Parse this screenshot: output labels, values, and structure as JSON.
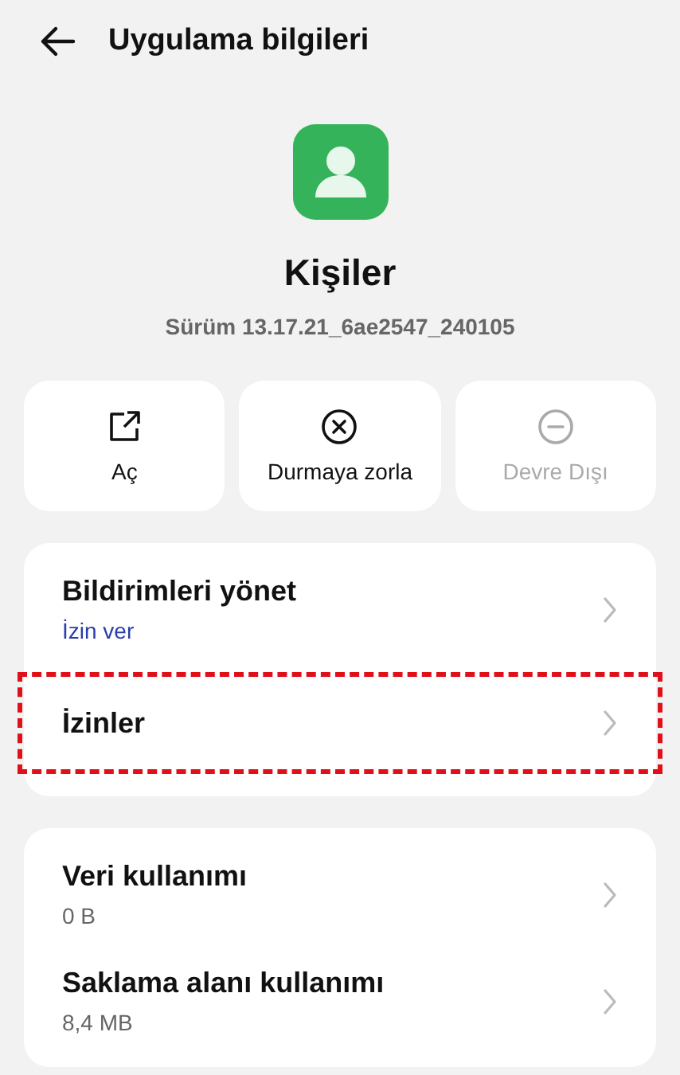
{
  "header": {
    "title": "Uygulama bilgileri"
  },
  "app": {
    "name": "Kişiler",
    "version": "Sürüm 13.17.21_6ae2547_240105"
  },
  "actions": [
    {
      "kind": "open",
      "label": "Aç",
      "disabled": false
    },
    {
      "kind": "stop",
      "label": "Durmaya zorla",
      "disabled": false
    },
    {
      "kind": "disable",
      "label": "Devre Dışı",
      "disabled": true
    }
  ],
  "sections": [
    {
      "items": [
        {
          "title": "Bildirimleri yönet",
          "subtitle": "İzin ver",
          "subtitle_link": true,
          "highlighted": false
        },
        {
          "title": "İzinler",
          "highlighted": true
        }
      ]
    },
    {
      "items": [
        {
          "title": "Veri kullanımı",
          "subtitle": "0 B",
          "subtitle_link": false,
          "highlighted": false
        },
        {
          "title": "Saklama alanı kullanımı",
          "subtitle": "8,4 MB",
          "subtitle_link": false,
          "highlighted": false
        }
      ]
    }
  ]
}
